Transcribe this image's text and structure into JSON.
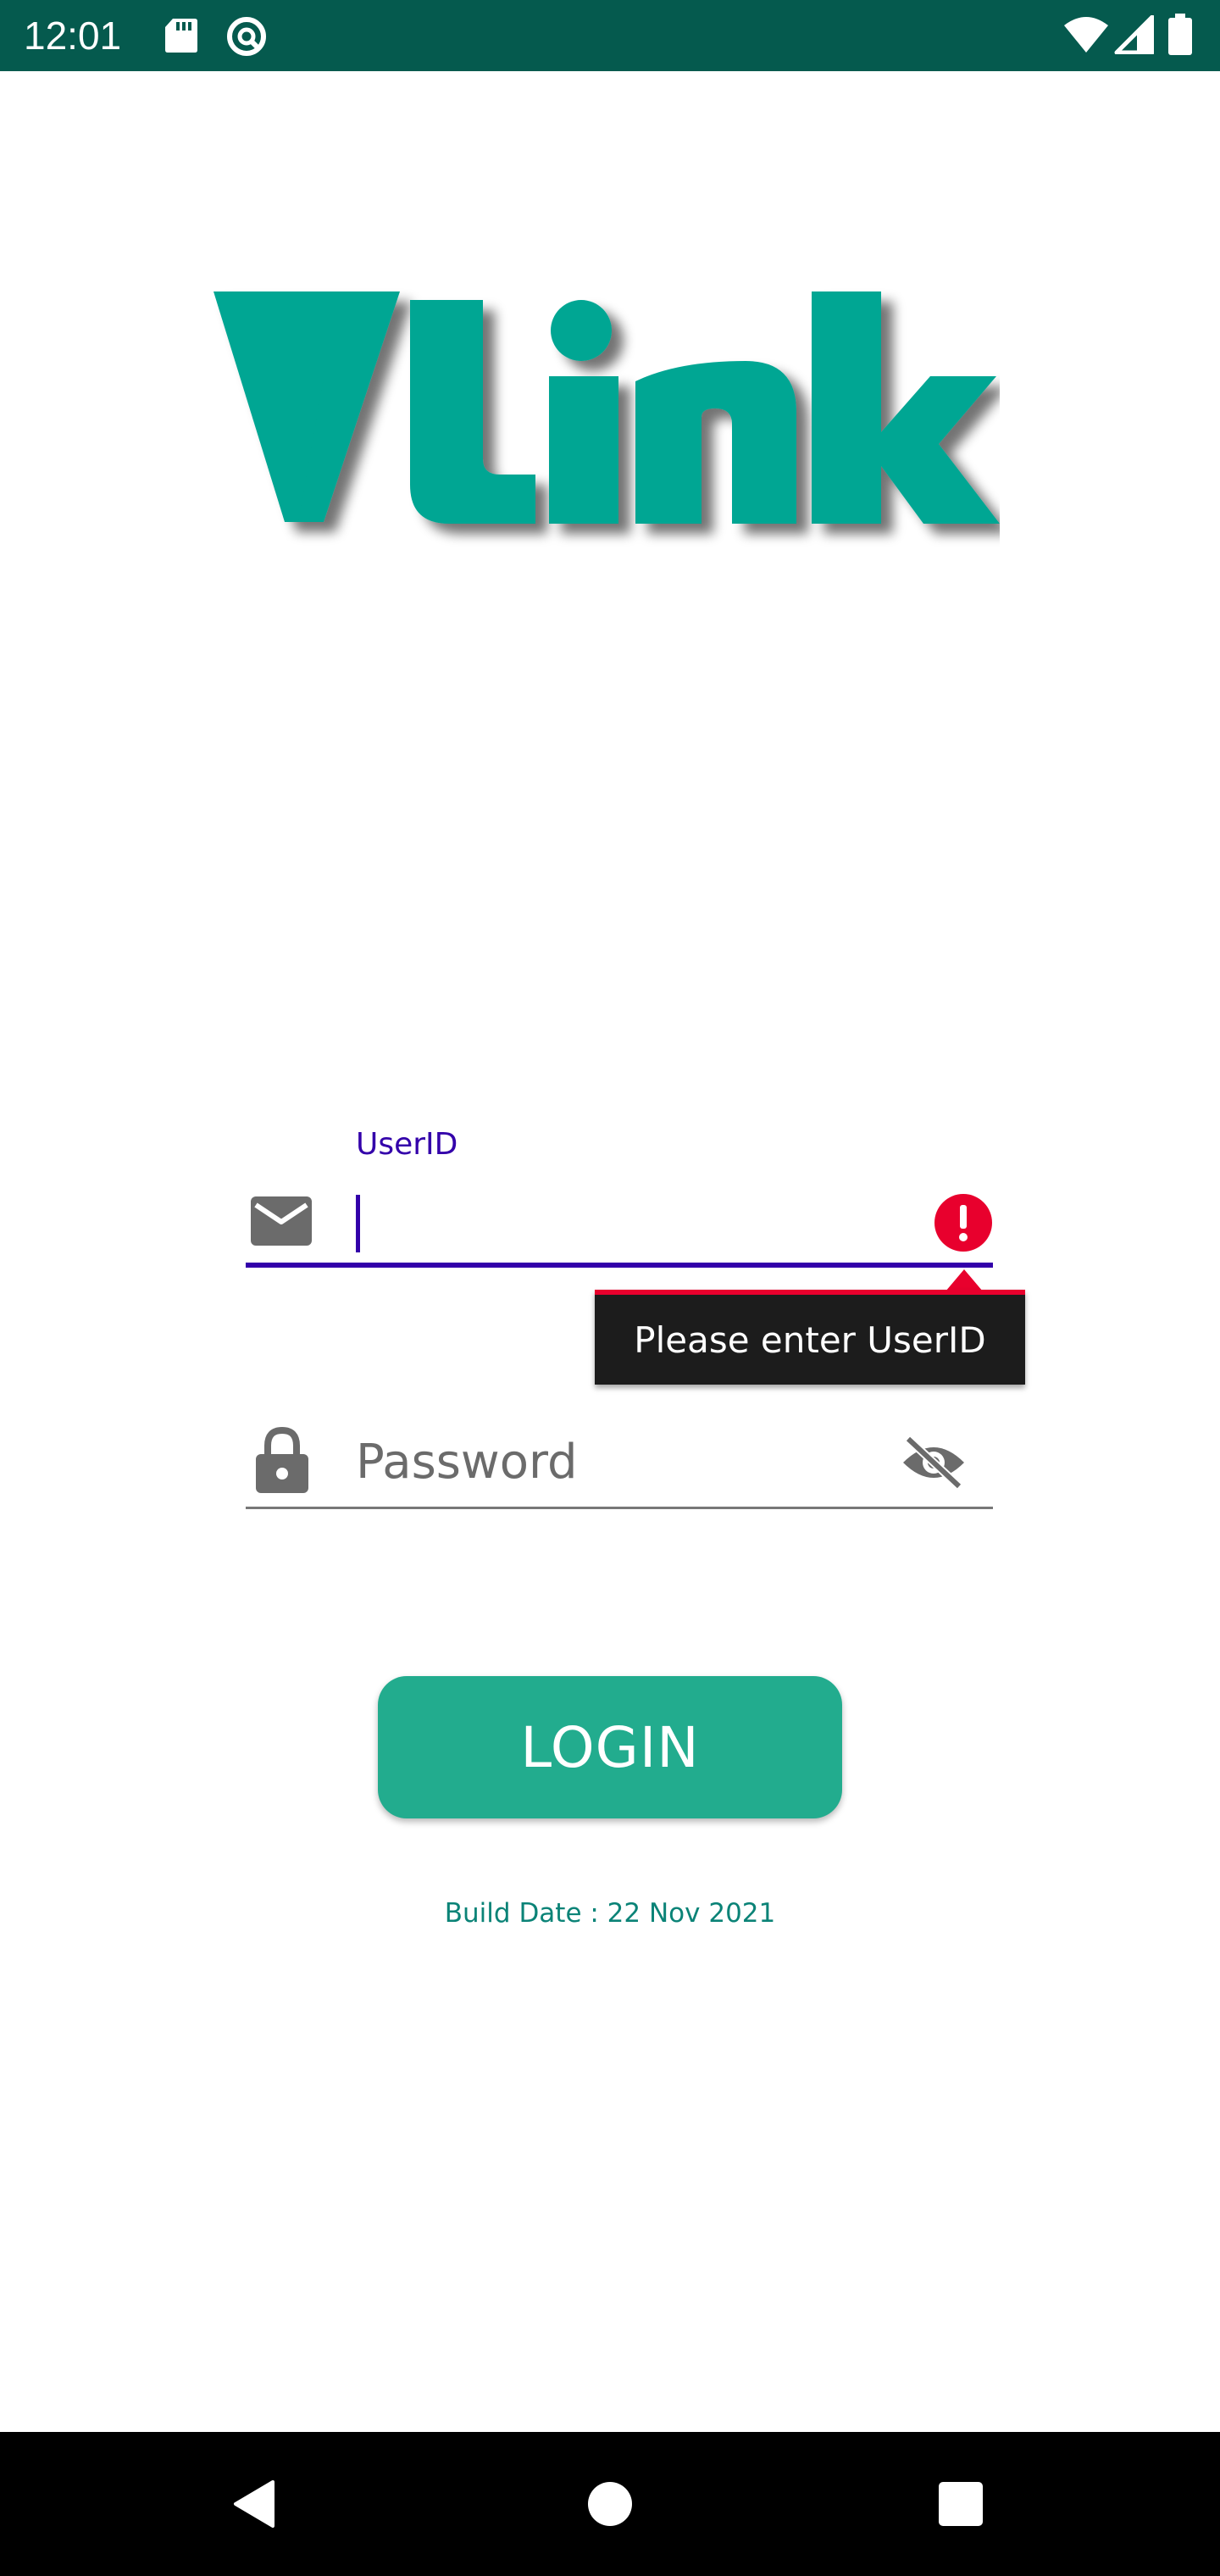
{
  "status_bar": {
    "time": "12:01",
    "background": "#055a4e",
    "icons": [
      "sd-card-icon",
      "at-sign-icon",
      "wifi-icon",
      "cellular-signal-icon",
      "battery-icon"
    ]
  },
  "logo": {
    "text": "Vlink",
    "color": "#00a693"
  },
  "userid_field": {
    "label": "UserID",
    "value": "",
    "icon": "mail-icon",
    "error_icon": "error-alert-icon",
    "active_color": "#3300aa"
  },
  "error_tooltip": {
    "message": "Please enter UserID",
    "background": "#1c1c1c",
    "accent": "#e8002d"
  },
  "password_field": {
    "placeholder": "Password",
    "value": "",
    "icon": "lock-icon",
    "toggle_icon": "eye-off-icon",
    "line_color": "#777777"
  },
  "login_button": {
    "label": "LOGIN",
    "color": "#22ac8e"
  },
  "build_date": {
    "text": "Build Date : 22 Nov 2021",
    "color": "#0b8377"
  },
  "nav_bar": {
    "buttons": [
      "back-icon",
      "home-icon",
      "recents-icon"
    ]
  }
}
